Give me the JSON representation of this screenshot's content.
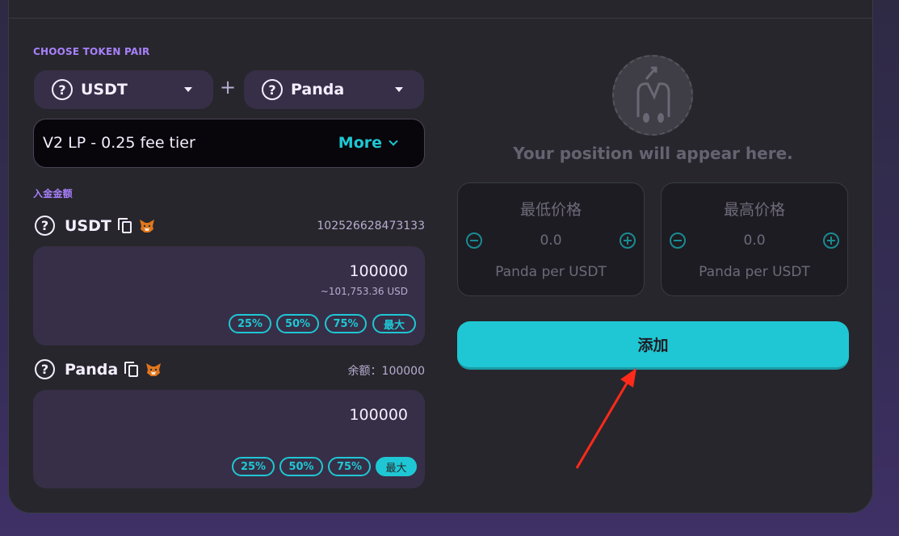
{
  "pair": {
    "section_label": "CHOOSE TOKEN PAIR",
    "token_a": {
      "name": "USDT",
      "icon": "question-circle-icon"
    },
    "plus": "+",
    "token_b": {
      "name": "Panda",
      "icon": "question-circle-icon"
    }
  },
  "fee": {
    "label": "V2 LP - 0.25 fee tier",
    "more_label": "More"
  },
  "deposit": {
    "section_label": "入金金额",
    "token_a": {
      "name": "USDT",
      "balance": "10252662847313​3",
      "amount": "100000",
      "usd_value": "~101,753.36 USD",
      "buttons": [
        "25%",
        "50%",
        "75%",
        "最大"
      ],
      "active_button": ""
    },
    "token_b": {
      "name": "Panda",
      "balance": "余额：100000",
      "amount": "100000",
      "buttons": [
        "25%",
        "50%",
        "75%",
        "最大"
      ],
      "active_button": "最大"
    }
  },
  "position": {
    "placeholder": "Your position will appear here."
  },
  "price_range": {
    "min": {
      "title": "最低价格",
      "value": "0.0",
      "unit": "Panda per USDT"
    },
    "max": {
      "title": "最高价格",
      "value": "0.0",
      "unit": "Panda per USDT"
    }
  },
  "add_button": "添加",
  "colors": {
    "accent": "#1fc7d4",
    "label_purple": "#a881fc",
    "annotation_arrow": "#ff2a1a"
  }
}
